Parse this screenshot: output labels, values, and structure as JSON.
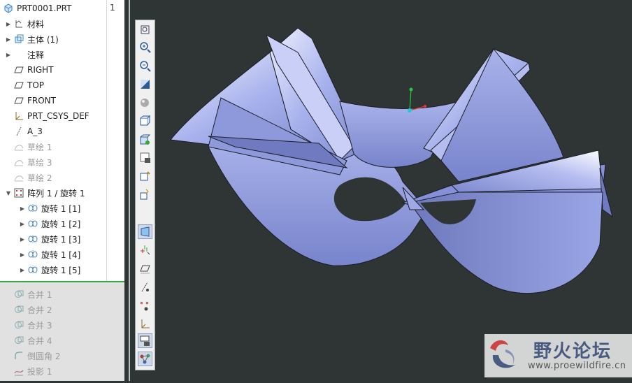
{
  "model_tree": {
    "root": "PRT0001.PRT",
    "column_header": "1",
    "items": [
      {
        "label": "材料",
        "icon": "material-icon",
        "expandable": true
      },
      {
        "label": "主体 (1)",
        "icon": "body-icon",
        "expandable": true
      },
      {
        "label": "注释",
        "icon": "",
        "expandable": true
      },
      {
        "label": "RIGHT",
        "icon": "datum-plane-icon",
        "expandable": false
      },
      {
        "label": "TOP",
        "icon": "datum-plane-icon",
        "expandable": false
      },
      {
        "label": "FRONT",
        "icon": "datum-plane-icon",
        "expandable": false
      },
      {
        "label": "PRT_CSYS_DEF",
        "icon": "csys-icon",
        "expandable": false
      },
      {
        "label": "A_3",
        "icon": "datum-axis-icon",
        "expandable": false
      },
      {
        "label": "草绘 1",
        "icon": "sketch-icon",
        "expandable": false,
        "dim": true
      },
      {
        "label": "草绘 3",
        "icon": "sketch-icon",
        "expandable": false,
        "dim": true
      },
      {
        "label": "草绘 2",
        "icon": "sketch-icon",
        "expandable": false,
        "dim": true
      },
      {
        "label": "阵列 1 / 旋转 1",
        "icon": "pattern-icon",
        "expandable": true,
        "expanded": true
      },
      {
        "label": "旋转 1 [1]",
        "icon": "revolve-icon",
        "expandable": true,
        "child": true
      },
      {
        "label": "旋转 1 [2]",
        "icon": "revolve-icon",
        "expandable": true,
        "child": true
      },
      {
        "label": "旋转 1 [3]",
        "icon": "revolve-icon",
        "expandable": true,
        "child": true
      },
      {
        "label": "旋转 1 [4]",
        "icon": "revolve-icon",
        "expandable": true,
        "child": true
      },
      {
        "label": "旋转 1 [5]",
        "icon": "revolve-icon",
        "expandable": true,
        "child": true
      }
    ],
    "inactive_items": [
      {
        "label": "合并 1",
        "icon": "merge-icon"
      },
      {
        "label": "合并 2",
        "icon": "merge-icon"
      },
      {
        "label": "合并 3",
        "icon": "merge-icon"
      },
      {
        "label": "合并 4",
        "icon": "merge-icon"
      },
      {
        "label": "倒圆角 2",
        "icon": "round-icon"
      },
      {
        "label": "投影 1",
        "icon": "project-icon"
      }
    ]
  },
  "toolbar": {
    "buttons": [
      "refit-icon",
      "zoom-in-icon",
      "zoom-out-icon",
      "repaint-icon",
      "appearance-icon",
      "display-style-icon",
      "saved-views-icon",
      "view-manager-icon",
      "named-view-icon",
      "reorient-icon",
      "perspective-icon",
      "spin-center-icon",
      "plane-display-icon",
      "axis-display-icon",
      "point-display-icon",
      "csys-display-icon",
      "annotation-display-icon",
      "model-display-icon"
    ],
    "active": "perspective-icon"
  },
  "watermark": {
    "title": "野火论坛",
    "url": "www.proewildfire.cn"
  },
  "colors": {
    "viewport_bg": "#2f3434",
    "surface": "#8f9ce0",
    "tree_bg": "#ffffff",
    "inactive_bg": "#e1e1e1",
    "selection_green": "#3aa447"
  }
}
